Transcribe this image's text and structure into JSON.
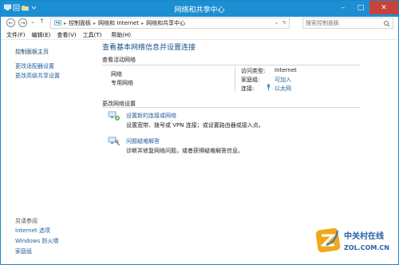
{
  "window": {
    "title": "网络和共享中心",
    "minimize": "–",
    "maximize": "□",
    "close": "✕"
  },
  "address": {
    "crumbs": [
      "控制面板",
      "网络和 Internet",
      "网络和共享中心"
    ],
    "search_placeholder": "搜索控制面板"
  },
  "menus": [
    "文件(F)",
    "编辑(E)",
    "查看(V)",
    "工具(T)",
    "帮助(H)"
  ],
  "sidebar": {
    "home": "控制面板主页",
    "links": [
      "更改适配器设置",
      "更改高级共享设置"
    ],
    "see_also_label": "另请参阅",
    "see_also": [
      "Internet 选项",
      "Windows 防火墙",
      "家庭组"
    ]
  },
  "main": {
    "heading": "查看基本网络信息并设置连接",
    "active_label": "查看活动网络",
    "network_name": "网络",
    "network_type": "专用网络",
    "access_label": "访问类型:",
    "access_value": "Internet",
    "homegroup_label": "家庭组:",
    "homegroup_value": "可加入",
    "conn_label": "连接:",
    "conn_value": "以太网",
    "change_label": "更改网络设置",
    "task1_title": "设置新的连接或网络",
    "task1_desc": "设置宽带、拨号或 VPN 连接；或设置路由器或接入点。",
    "task2_title": "问题疑难解答",
    "task2_desc": "诊断并修复网络问题，或者获得疑难解答信息。"
  },
  "watermark": {
    "cn": "中关村在线",
    "en": "ZOL.COM.CN"
  },
  "colors": {
    "titlebar": "#1c8fd3",
    "link": "#1f5e9a",
    "heading": "#1a4e86"
  }
}
